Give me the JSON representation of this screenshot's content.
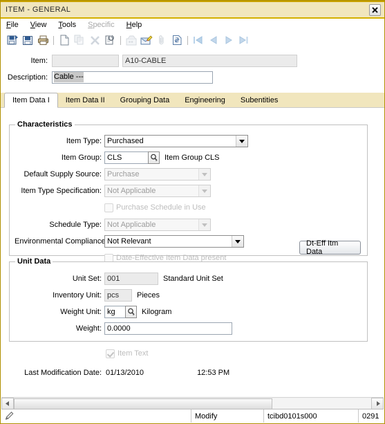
{
  "window": {
    "title": "ITEM - GENERAL",
    "close_label": "✖"
  },
  "menubar": {
    "items": [
      {
        "label": "File",
        "accel": "F",
        "disabled": false
      },
      {
        "label": "View",
        "accel": "V",
        "disabled": false
      },
      {
        "label": "Tools",
        "accel": "T",
        "disabled": false
      },
      {
        "label": "Specific",
        "accel": "S",
        "disabled": true
      },
      {
        "label": "Help",
        "accel": "H",
        "disabled": false
      }
    ]
  },
  "toolbar": {
    "buttons": [
      {
        "name": "save-and-new-icon",
        "disabled": false
      },
      {
        "name": "save-icon",
        "disabled": false
      },
      {
        "name": "print-icon",
        "disabled": false
      },
      {
        "name": "separator-1",
        "sep": true
      },
      {
        "name": "new-document-icon",
        "disabled": false
      },
      {
        "name": "copy-icon",
        "disabled": true
      },
      {
        "name": "delete-icon",
        "disabled": true
      },
      {
        "name": "rotate-document-icon",
        "disabled": false
      },
      {
        "name": "separator-2",
        "sep": true
      },
      {
        "name": "find-icon",
        "disabled": true
      },
      {
        "name": "edit-note-icon",
        "disabled": false
      },
      {
        "name": "attachment-icon",
        "disabled": true
      },
      {
        "name": "refresh-document-icon",
        "disabled": false
      },
      {
        "name": "separator-3",
        "sep": true
      },
      {
        "name": "first-record-icon",
        "disabled": false
      },
      {
        "name": "previous-record-icon",
        "disabled": false
      },
      {
        "name": "next-record-icon",
        "disabled": false
      },
      {
        "name": "last-record-icon",
        "disabled": false
      }
    ]
  },
  "header": {
    "item_label": "Item:",
    "item_code": "",
    "item_value": "A10-CABLE",
    "description_label": "Description:",
    "description_value": "Cable ---"
  },
  "tabs": [
    {
      "label": "Item Data I",
      "active": true
    },
    {
      "label": "Item Data II",
      "active": false
    },
    {
      "label": "Grouping Data",
      "active": false
    },
    {
      "label": "Engineering",
      "active": false
    },
    {
      "label": "Subentities",
      "active": false
    }
  ],
  "characteristics": {
    "title": "Characteristics",
    "item_type_label": "Item Type:",
    "item_type_value": "Purchased",
    "item_group_label": "Item Group:",
    "item_group_value": "CLS",
    "item_group_desc": "Item Group CLS",
    "default_supply_source_label": "Default Supply Source:",
    "default_supply_source_value": "Purchase",
    "item_type_specification_label": "Item Type Specification:",
    "item_type_specification_value": "Not Applicable",
    "purchase_schedule_label": "Purchase Schedule in Use",
    "purchase_schedule_checked": false,
    "schedule_type_label": "Schedule Type:",
    "schedule_type_value": "Not Applicable",
    "environmental_compliance_label": "Environmental Compliance:",
    "environmental_compliance_value": "Not Relevant",
    "date_effective_label": "Date-Effective Item Data present",
    "date_effective_checked": false,
    "dt_eff_button_label": "Dt-Eff Itm Data"
  },
  "unit_data": {
    "title": "Unit Data",
    "unit_set_label": "Unit Set:",
    "unit_set_value": "001",
    "unit_set_desc": "Standard Unit Set",
    "inventory_unit_label": "Inventory Unit:",
    "inventory_unit_value": "pcs",
    "inventory_unit_desc": "Pieces",
    "weight_unit_label": "Weight Unit:",
    "weight_unit_value": "kg",
    "weight_unit_desc": "Kilogram",
    "weight_label": "Weight:",
    "weight_value": "0.0000"
  },
  "footer": {
    "item_text_label": "Item Text",
    "item_text_checked": true,
    "last_modification_label": "Last Modification Date:",
    "last_modification_date": "01/13/2010",
    "last_modification_time": "12:53 PM"
  },
  "statusbar": {
    "mode": "Modify",
    "session": "tcibd0101s000",
    "code": "0291"
  },
  "colors": {
    "title_bar": "#f1e6bd",
    "title_accent": "#d4af00",
    "tab_strip": "#f1e6bd"
  }
}
